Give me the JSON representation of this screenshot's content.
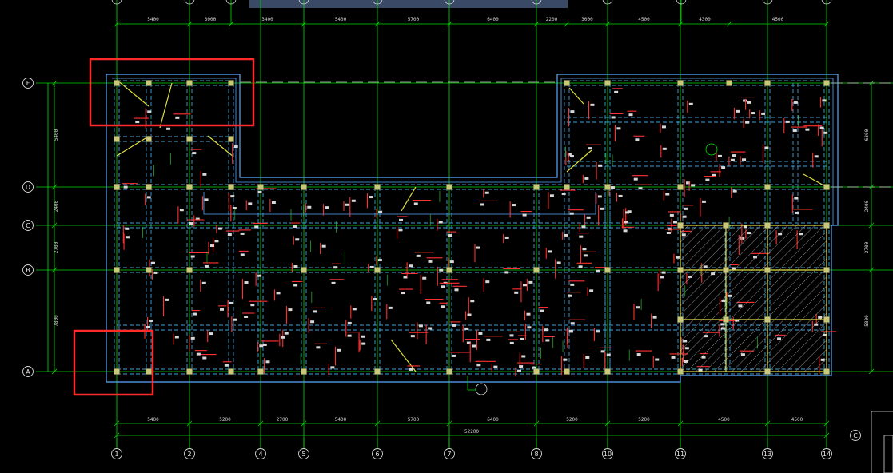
{
  "title_bar": {
    "text": ""
  },
  "axes": {
    "columns": [
      "1",
      "2",
      "4",
      "5",
      "6",
      "7",
      "8",
      "10",
      "11",
      "13",
      "14"
    ],
    "rows": [
      "F",
      "D",
      "C",
      "B",
      "A"
    ],
    "extra_bubble": "C"
  },
  "dimensions": {
    "top": [
      "5400",
      "3000",
      "3400",
      "5400",
      "5700",
      "6400",
      "2200",
      "3000",
      "4500",
      "4300",
      "4500"
    ],
    "bottom": [
      "5400",
      "5200",
      "2700",
      "5400",
      "5700",
      "6400",
      "5200",
      "5200",
      "4500",
      "4500"
    ],
    "overall": "52200",
    "left": [
      "5400",
      "2400",
      "2700",
      "7800"
    ],
    "right": [
      "6300",
      "2400",
      "2700",
      "5800"
    ]
  },
  "colors": {
    "grid": "#00dd00",
    "beam": "#3fa0d8",
    "outline": "#5aa8ff",
    "rebar": "#ff3030",
    "column": "#c8c878",
    "highlight": "#e0e040",
    "annotation": "#ff2a2a"
  }
}
